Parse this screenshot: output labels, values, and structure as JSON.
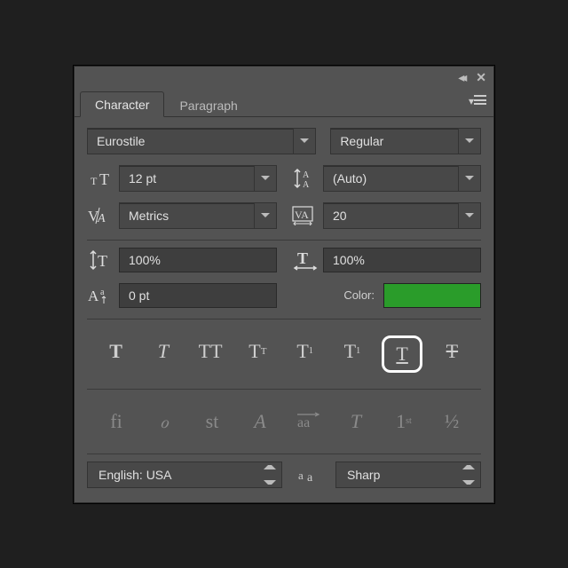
{
  "tabs": {
    "character": "Character",
    "paragraph": "Paragraph"
  },
  "font": {
    "family": "Eurostile",
    "style": "Regular"
  },
  "size": "12 pt",
  "leading": "(Auto)",
  "kerning": "Metrics",
  "tracking": "20",
  "vscale": "100%",
  "hscale": "100%",
  "baseline": "0 pt",
  "colorLabel": "Color:",
  "color": "#2a9c2a",
  "lang": "English: USA",
  "aa": "Sharp",
  "styleButtons": {
    "fauxBold": "T",
    "fauxItalic": "T",
    "allCaps": "TT",
    "smallCaps": "T",
    "superscript": "T",
    "subscript": "T",
    "underline": "T",
    "strike": "T"
  },
  "otButtons": {
    "ligatures": "fi",
    "contextual": "ℴ",
    "stylistic": "st",
    "swash": "A",
    "alternates": "aa",
    "titling": "T",
    "ordinals": "1",
    "fractions": "½"
  }
}
